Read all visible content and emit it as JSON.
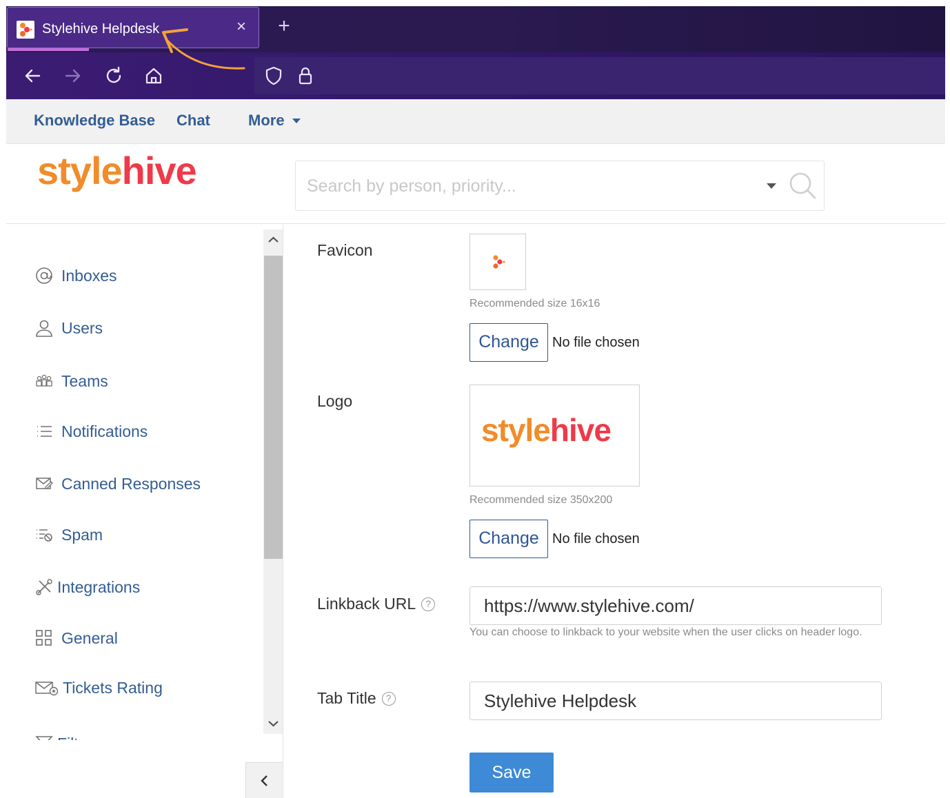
{
  "browser": {
    "tab_title": "Stylehive Helpdesk",
    "tab_close": "×",
    "new_tab": "+"
  },
  "appnav": {
    "knowledge_base": "Knowledge Base",
    "chat": "Chat",
    "more": "More"
  },
  "header": {
    "logo_part1": "style",
    "logo_part2": "hive",
    "search_placeholder": "Search by person, priority..."
  },
  "sidebar": {
    "items": [
      {
        "label": "Inboxes",
        "icon": "at-icon"
      },
      {
        "label": "Users",
        "icon": "user-icon"
      },
      {
        "label": "Teams",
        "icon": "teams-icon"
      },
      {
        "label": "Notifications",
        "icon": "list-icon"
      },
      {
        "label": "Canned Responses",
        "icon": "envelope-icon"
      },
      {
        "label": "Spam",
        "icon": "spam-icon"
      },
      {
        "label": "Integrations",
        "icon": "tools-icon"
      },
      {
        "label": "General",
        "icon": "grid-icon"
      },
      {
        "label": "Tickets Rating",
        "icon": "envelope-rating-icon"
      },
      {
        "label": "Filters",
        "icon": "filter-icon"
      }
    ]
  },
  "settings": {
    "favicon_label": "Favicon",
    "favicon_hint": "Recommended size 16x16",
    "change_label": "Change",
    "no_file": "No file chosen",
    "logo_label": "Logo",
    "logo_hint": "Recommended size 350x200",
    "linkback_label": "Linkback URL",
    "linkback_value": "https://www.stylehive.com/",
    "linkback_hint": "You can choose to linkback to your website when the user clicks on header logo.",
    "tab_title_label": "Tab Title",
    "tab_title_value": "Stylehive Helpdesk",
    "help_glyph": "?",
    "save_label": "Save"
  },
  "colors": {
    "brand_orange": "#f08c2a",
    "brand_red": "#ee3a4a",
    "link_blue": "#335d93",
    "save_blue": "#3e8ad6",
    "browser_purple": "#2c1a52"
  }
}
